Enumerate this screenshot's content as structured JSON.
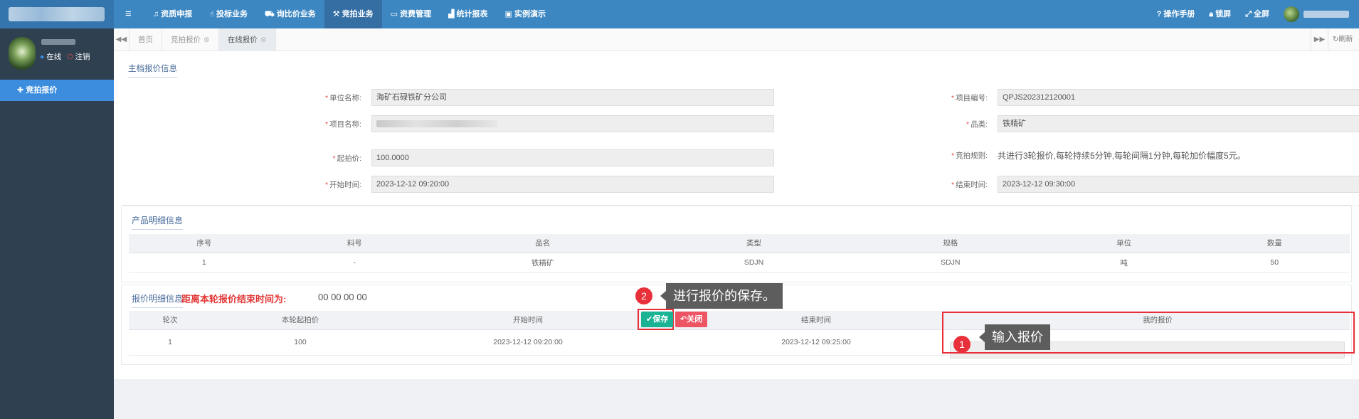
{
  "topbar": {
    "menu_icon": "hamburger-icon",
    "nav": [
      {
        "label": "资质申报",
        "icon": "bell-icon"
      },
      {
        "label": "投标业务",
        "icon": "hand-icon"
      },
      {
        "label": "询比价业务",
        "icon": "cart-icon"
      },
      {
        "label": "竞拍业务",
        "icon": "gavel-icon",
        "active": true
      },
      {
        "label": "资费管理",
        "icon": "card-icon"
      },
      {
        "label": "统计报表",
        "icon": "chart-icon"
      },
      {
        "label": "实例演示",
        "icon": "monitor-icon"
      }
    ],
    "right": {
      "manual": "操作手册",
      "lock": "锁屏",
      "fullscreen": "全屏"
    }
  },
  "sidebar": {
    "status_online": "在线",
    "status_logout": "注销",
    "menu_item": "竞拍报价"
  },
  "tabs": {
    "items": [
      "首页",
      "竞拍报价",
      "在线报价"
    ],
    "active_index": 2,
    "refresh": "刷新"
  },
  "main_info": {
    "title": "主档报价信息",
    "unit_label": "单位名称:",
    "unit_value": "海矿石碌铁矿分公司",
    "project_no_label": "项目编号:",
    "project_no_value": "QPJS202312120001",
    "project_name_label": "项目名称:",
    "category_label": "品类:",
    "category_value": "铁精矿",
    "start_price_label": "起拍价:",
    "start_price_value": "100.0000",
    "rule_label": "竞拍规则:",
    "rule_value": "共进行3轮报价,每轮持续5分钟,每轮间隔1分钟,每轮加价幅度5元。",
    "start_time_label": "开始时间:",
    "start_time_value": "2023-12-12 09:20:00",
    "end_time_label": "结束时间:",
    "end_time_value": "2023-12-12 09:30:00"
  },
  "product": {
    "title": "产品明细信息",
    "headers": [
      "序号",
      "料号",
      "品名",
      "类型",
      "规格",
      "单位",
      "数量"
    ],
    "rows": [
      [
        "1",
        "-",
        "铁精矿",
        "SDJN",
        "SDJN",
        "吨",
        "50"
      ]
    ]
  },
  "bid": {
    "title": "报价明细信息",
    "countdown_label": "距离本轮报价结束时间为:",
    "countdown_value": "00 00 00 00",
    "headers": [
      "轮次",
      "本轮起拍价",
      "开始时间",
      "结束时间",
      "我的报价"
    ],
    "rows": [
      [
        "1",
        "100",
        "2023-12-12 09:20:00",
        "2023-12-12 09:25:00"
      ]
    ]
  },
  "annotations": {
    "step1_num": "1",
    "step1_text": "输入报价",
    "step2_num": "2",
    "step2_text": "进行报价的保存。"
  },
  "buttons": {
    "save": "保存",
    "close": "关闭"
  },
  "colors": {
    "topbar": "#3c87c2",
    "sidebar": "#2f4050",
    "sidebar_active": "#3c8dde",
    "save": "#1ab394",
    "close": "#ed5565",
    "highlight": "#e8303a"
  }
}
